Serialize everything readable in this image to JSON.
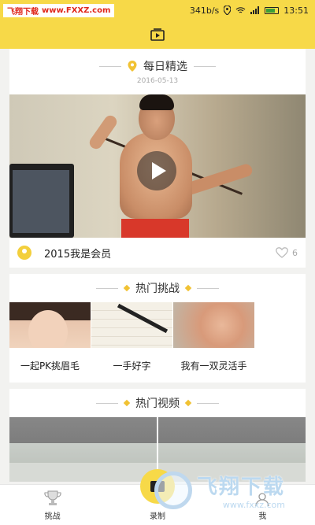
{
  "watermark": {
    "top_left_brand": "飞翔下载",
    "top_left_url": "www.FXXZ.com",
    "bottom_right_brand": "飞翔下载",
    "bottom_right_url": "www.fxxz.com"
  },
  "status_bar": {
    "speed": "341b/s",
    "time": "13:51",
    "battery_level": 0.75,
    "icons": [
      "location-icon",
      "wifi-icon",
      "signal-icon",
      "battery-icon"
    ]
  },
  "header": {
    "logo_icon": "tv-play-icon",
    "bg_color": "#f7d948"
  },
  "daily_pick": {
    "title": "每日精选",
    "date": "2016-05-13",
    "video": {
      "title": "2015我是会员",
      "likes": "6"
    }
  },
  "hot_challenges": {
    "title": "热门挑战",
    "items": [
      {
        "label": "一起PK挑眉毛"
      },
      {
        "label": "一手好字"
      },
      {
        "label": "我有一双灵活手"
      }
    ]
  },
  "hot_videos": {
    "title": "热门视频"
  },
  "bottom_nav": {
    "items": [
      {
        "label": "挑战",
        "icon": "trophy-icon"
      },
      {
        "label": "录制",
        "icon": "camera-icon"
      },
      {
        "label": "我",
        "icon": "user-icon"
      }
    ]
  },
  "colors": {
    "accent": "#f7d948",
    "diamond": "#f1c233"
  }
}
